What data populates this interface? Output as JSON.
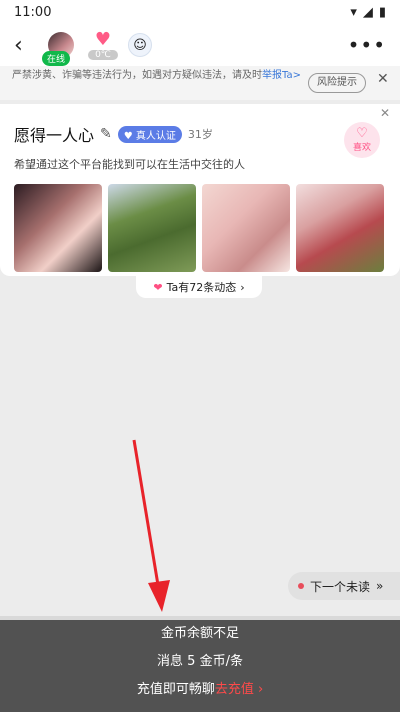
{
  "status": {
    "time": "11:00"
  },
  "nav": {
    "online_label": "在线",
    "temperature": "0℃"
  },
  "warning": {
    "text": "严禁涉黄、诈骗等违法行为，如遇对方疑似违法，请及时",
    "report_label": "举报Ta>",
    "risk_button": "风险提示"
  },
  "profile": {
    "name": "愿得一人心",
    "verified_label": "真人认证",
    "age": "31岁",
    "like_label": "喜欢",
    "bio": "希望通过这个平台能找到可以在生活中交往的人"
  },
  "moments": {
    "label": "Ta有72条动态"
  },
  "next_unread": {
    "label": "下一个未读"
  },
  "toast": {
    "line1": "金币余额不足",
    "line2": "消息 5 金币/条",
    "line3_prefix": "充值即可畅聊",
    "line3_action": "去充值"
  },
  "colors": {
    "accent_pink": "#ff4f83",
    "verified_blue": "#5b7ce6",
    "online_green": "#11b84a",
    "link_blue": "#3a78d8"
  },
  "icons": [
    "back-arrow-icon",
    "heart-icon",
    "more-icon",
    "close-icon",
    "edit-icon",
    "shield-icon",
    "chevron-right-icon"
  ]
}
